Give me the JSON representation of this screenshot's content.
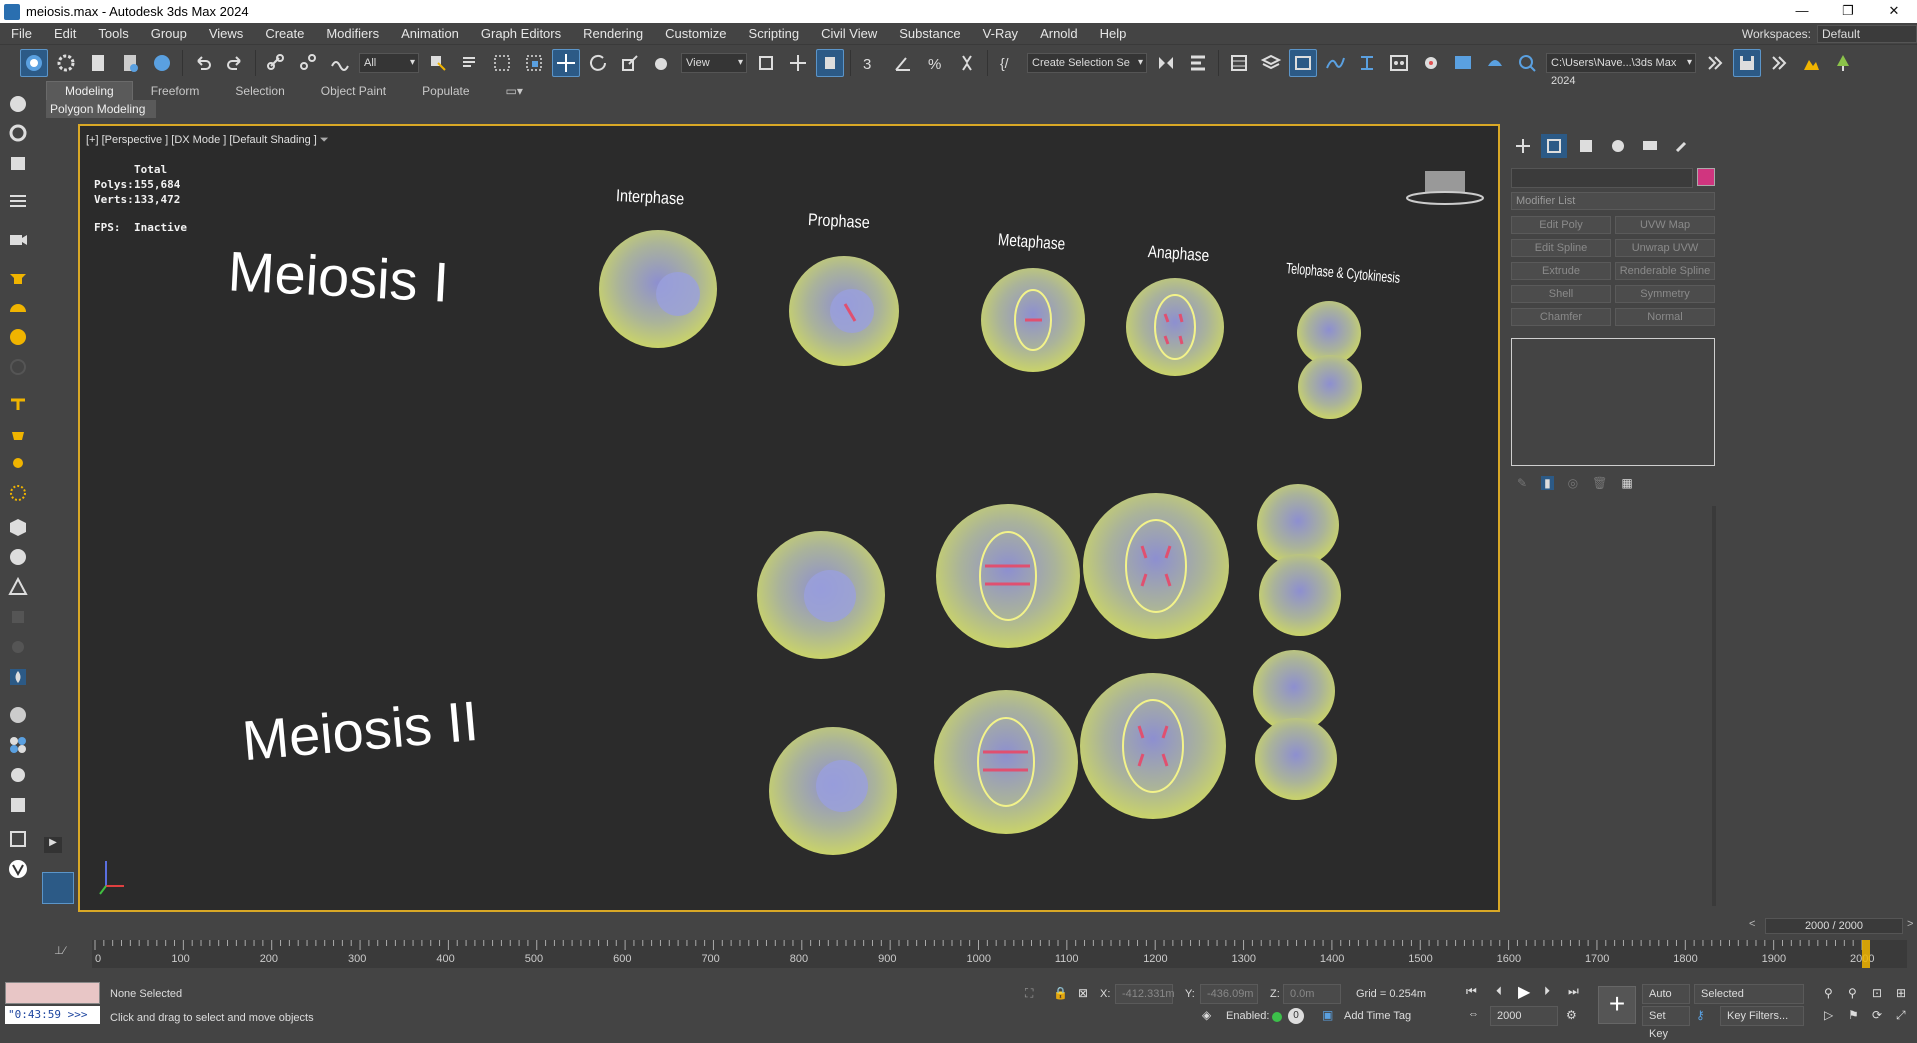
{
  "window": {
    "title": "meiosis.max - Autodesk 3ds Max 2024"
  },
  "menu": [
    "File",
    "Edit",
    "Tools",
    "Group",
    "Views",
    "Create",
    "Modifiers",
    "Animation",
    "Graph Editors",
    "Rendering",
    "Customize",
    "Scripting",
    "Civil View",
    "Substance",
    "V-Ray",
    "Arnold",
    "Help"
  ],
  "workspaces": {
    "label": "Workspaces:",
    "value": "Default"
  },
  "toolbar": {
    "filter_value": "All",
    "refcoord_value": "View",
    "selection_set_value": "Create Selection Se",
    "project_path": "C:\\Users\\Nave...\\3ds Max 2024"
  },
  "ribbon": {
    "tabs": [
      "Modeling",
      "Freeform",
      "Selection",
      "Object Paint",
      "Populate"
    ],
    "active": "Modeling",
    "sub": "Polygon Modeling"
  },
  "viewport": {
    "label": "[+] [Perspective ] [DX Mode ] [Default Shading ]",
    "stats": {
      "total_label": "Total",
      "polys_label": "Polys:",
      "polys": "155,684",
      "verts_label": "Verts:",
      "verts": "133,472",
      "fps_label": "FPS:",
      "fps": "Inactive"
    },
    "headings": {
      "meiosis1": "Meiosis I",
      "meiosis2": "Meiosis II"
    },
    "phases": [
      "Interphase",
      "Prophase",
      "Metaphase",
      "Anaphase",
      "Telophase & Cytokinesis"
    ]
  },
  "command_panel": {
    "modifier_list": "Modifier List",
    "buttons": [
      "Edit Poly",
      "UVW Map",
      "Edit Spline",
      "Unwrap UVW",
      "Extrude",
      "Renderable Spline",
      "Shell",
      "Symmetry",
      "Chamfer",
      "Normal"
    ],
    "color_swatch": "#d0357f",
    "frame_counter": "2000 / 2000"
  },
  "timeline": {
    "ticks": [
      "0",
      "100",
      "200",
      "300",
      "400",
      "500",
      "600",
      "700",
      "800",
      "900",
      "1000",
      "1100",
      "1200",
      "1300",
      "1400",
      "1500",
      "1600",
      "1700",
      "1800",
      "1900",
      "2000"
    ]
  },
  "status": {
    "selection": "None Selected",
    "prompt": "Click and drag to select and move objects",
    "script_field": "\"0:43:59 >>>",
    "x_label": "X:",
    "x": "-412.331m",
    "y_label": "Y:",
    "y": "-436.09m",
    "z_label": "Z:",
    "z": "0.0m",
    "grid": "Grid = 0.254m",
    "enabled_label": "Enabled:",
    "add_time_tag": "Add Time Tag",
    "auto_key": "Auto Key",
    "selected": "Selected",
    "set_key": "Set Key",
    "key_filters": "Key Filters...",
    "frame": "2000",
    "zero": "0"
  }
}
